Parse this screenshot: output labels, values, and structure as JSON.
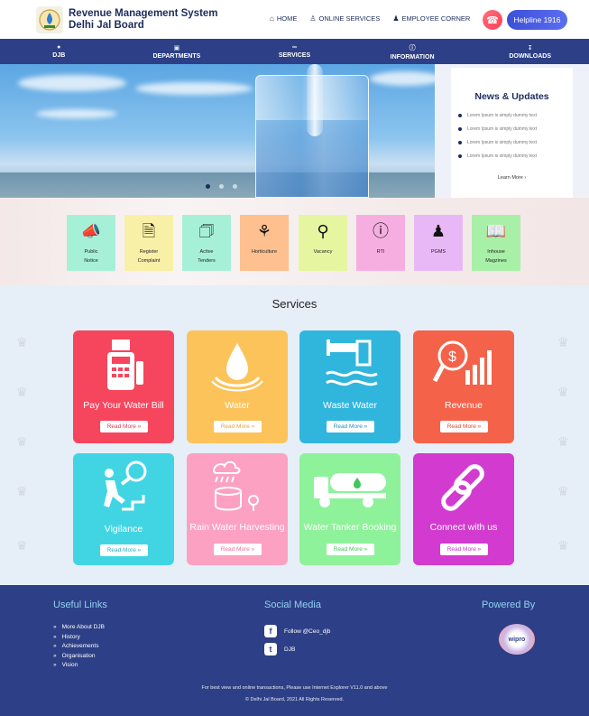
{
  "header": {
    "title_line1": "Revenue Management System",
    "title_line2": "Delhi Jal Board",
    "nav": [
      {
        "label": "HOME",
        "icon": "home-icon"
      },
      {
        "label": "ONLINE SERVICES",
        "icon": "user-icon"
      },
      {
        "label": "EMPLOYEE CORNER",
        "icon": "users-icon"
      }
    ],
    "helpline": "Helpline 1916"
  },
  "mainnav": [
    {
      "label": "DJB",
      "icon": "drop-icon"
    },
    {
      "label": "DEPARTMENTS",
      "icon": "building-icon"
    },
    {
      "label": "SERVICES",
      "icon": "link-icon"
    },
    {
      "label": "INFORMATION",
      "icon": "info-icon"
    },
    {
      "label": "DOWNLOADS",
      "icon": "download-icon"
    }
  ],
  "news": {
    "title": "News & Updates",
    "items": [
      "Lorem Ipsum is simply dummy text",
      "Lorem Ipsum is simply dummy text",
      "Lorem Ipsum is simply dummy text",
      "Lorem Ipsum is simply dummy text"
    ],
    "learn_more": "Learn More"
  },
  "quick_tiles": [
    {
      "line1": "Public",
      "line2": "Notice",
      "color": "#a6f0d8",
      "icon": "megaphone-icon"
    },
    {
      "line1": "Register",
      "line2": "Complaint",
      "color": "#f9f0a8",
      "icon": "document-icon"
    },
    {
      "line1": "Active",
      "line2": "Tenders",
      "color": "#a6f0d8",
      "icon": "files-icon"
    },
    {
      "line1": "Horticulture",
      "line2": "",
      "color": "#fdc08e",
      "icon": "plant-icon"
    },
    {
      "line1": "Vacancy",
      "line2": "",
      "color": "#e6f6a0",
      "icon": "magnifier-icon"
    },
    {
      "line1": "RTI",
      "line2": "",
      "color": "#f6aee0",
      "icon": "info-person-icon"
    },
    {
      "line1": "PGMS",
      "line2": "",
      "color": "#e8b8f6",
      "icon": "person-icon"
    },
    {
      "line1": "Inhouse",
      "line2": "Magzines",
      "color": "#a8f0a8",
      "icon": "book-icon"
    }
  ],
  "services": {
    "title": "Services",
    "read_more": "Read More »",
    "cards": [
      {
        "label": "Pay Your Water Bill",
        "color": "#f5465e",
        "btn_color": "#e23b54",
        "icon": "bill-machine-icon"
      },
      {
        "label": "Water",
        "color": "#fcc35a",
        "btn_color": "#e6a23a",
        "icon": "water-drop-icon"
      },
      {
        "label": "Waste Water",
        "color": "#30b6dd",
        "btn_color": "#1d94bd",
        "icon": "drain-pipe-icon"
      },
      {
        "label": "Revenue",
        "color": "#f5624a",
        "btn_color": "#e24a34",
        "icon": "revenue-chart-icon"
      },
      {
        "label": "Vigilance",
        "color": "#41d5e4",
        "btn_color": "#1fb3c8",
        "icon": "climber-icon"
      },
      {
        "label": "Rain Water Harvesting",
        "color": "#fca1c2",
        "btn_color": "#ee6f9c",
        "icon": "rain-tank-icon"
      },
      {
        "label": "Water Tanker Booking",
        "color": "#8ef29a",
        "btn_color": "#3fc85a",
        "icon": "tanker-icon"
      },
      {
        "label": "Connect with us",
        "color": "#d33bd0",
        "btn_color": "#c036c8",
        "icon": "chain-link-icon"
      }
    ]
  },
  "footer": {
    "useful_title": "Useful Links",
    "links": [
      "More About DJB",
      "History",
      "Achievements",
      "Organisation",
      "Vision"
    ],
    "social_title": "Social Media",
    "social": [
      {
        "label": "Follow @Ceo_djb",
        "icon": "facebook-icon"
      },
      {
        "label": "DJB",
        "icon": "twitter-icon"
      }
    ],
    "powered_title": "Powered By",
    "powered_logo": "wipro",
    "note": "For best view and online transactions, Please use Internet Explorer V11.0 and above",
    "copyright": "© Delhi Jal Board, 2021 All Rights Reserved."
  }
}
